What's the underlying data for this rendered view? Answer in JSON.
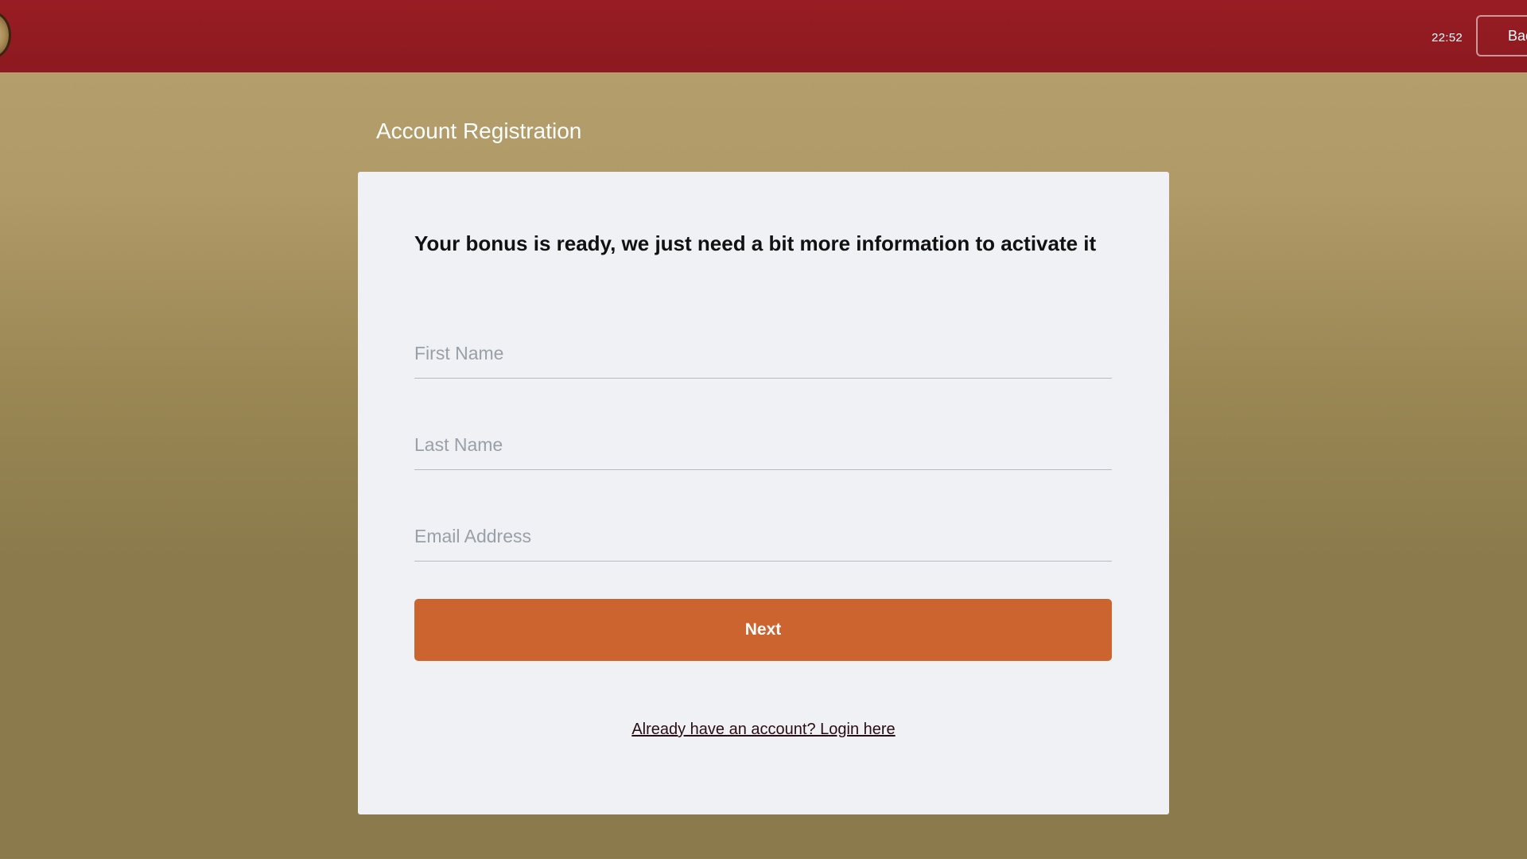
{
  "header": {
    "logo_icon": "casino-emblem-icon",
    "clock": "22:52",
    "back_label": "Back"
  },
  "page": {
    "title": "Account Registration"
  },
  "form": {
    "headline": "Your bonus is ready, we just need a bit more information to activate it",
    "fields": {
      "first_name": {
        "placeholder": "First Name",
        "value": ""
      },
      "last_name": {
        "placeholder": "Last Name",
        "value": ""
      },
      "email": {
        "placeholder": "Email Address",
        "value": ""
      }
    },
    "next_label": "Next",
    "login_link": "Already have an account? Login here"
  },
  "colors": {
    "header_bg": "#981c23",
    "page_bg_top": "#b6a06e",
    "page_bg_bottom": "#8b7b4c",
    "card_bg": "#eff1f4",
    "button_bg": "#cb642f"
  }
}
